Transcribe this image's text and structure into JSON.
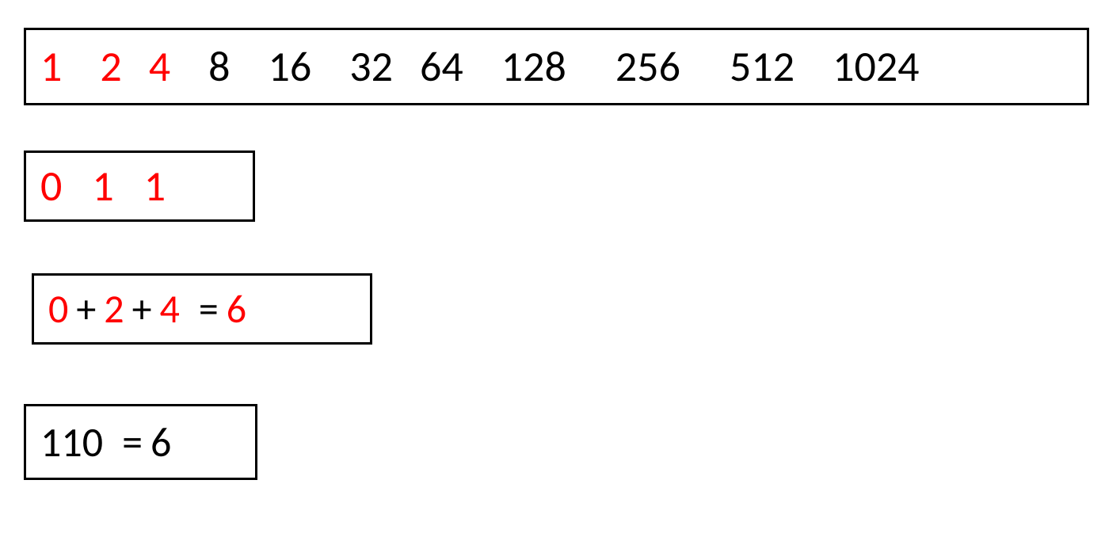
{
  "row1": {
    "values": [
      "1",
      "2",
      "4",
      "8",
      "16",
      "32",
      "64",
      "128",
      "256",
      "512",
      "1024"
    ],
    "red_count": 3
  },
  "row2": {
    "bits": [
      "0",
      "1",
      "1"
    ]
  },
  "row3": {
    "a": "0",
    "b": "2",
    "c": "4",
    "sum": "6"
  },
  "row4": {
    "binary": "110",
    "decimal": "6"
  },
  "ops": {
    "plus": "+",
    "eq": "="
  }
}
